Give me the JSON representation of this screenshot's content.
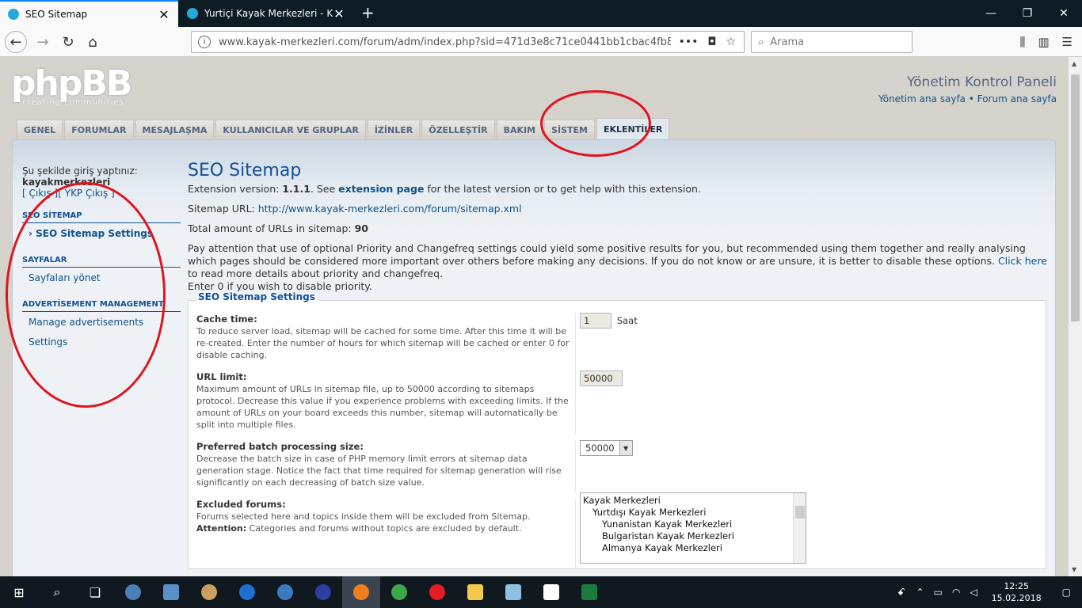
{
  "browser": {
    "tabs": [
      {
        "title": "SEO Sitemap"
      },
      {
        "title": "Yurtiçi Kayak Merkezleri - Kayak"
      }
    ],
    "url": "www.kayak-merkezleri.com/forum/adm/index.php?sid=471d3e8c71ce0441bb1cbac4fb8",
    "search_placeholder": "Arama",
    "new_tab": "+",
    "close_glyph": "✕",
    "page_actions": "•••"
  },
  "header": {
    "logo_text": "phpBB",
    "logo_tagline": "creating   communities",
    "title": "Yönetim Kontrol Paneli",
    "links": "Yönetim ana sayfa • Forum ana sayfa"
  },
  "nav_tabs": [
    {
      "label": "GENEL"
    },
    {
      "label": "FORUMLAR"
    },
    {
      "label": "MESAJLAŞMA"
    },
    {
      "label": "KULLANICILAR VE GRUPLAR"
    },
    {
      "label": "İZİNLER"
    },
    {
      "label": "ÖZELLEŞTİR"
    },
    {
      "label": "BAKIM"
    },
    {
      "label": "SİSTEM"
    },
    {
      "label": "EKLENTİLER"
    }
  ],
  "sidebar": {
    "login_text": "Şu şekilde giriş yaptınız:",
    "username": "kayakmerkezleri",
    "actions": "[ Çıkış ][ YKP Çıkış ]",
    "sections": [
      {
        "title": "SEO SİTEMAP",
        "items": [
          {
            "label": "SEO Sitemap Settings"
          }
        ]
      },
      {
        "title": "SAYFALAR",
        "items": [
          {
            "label": "Sayfaları yönet"
          }
        ]
      },
      {
        "title": "ADVERTİSEMENT MANAGEMENT",
        "items": [
          {
            "label": "Manage advertisements"
          },
          {
            "label": "Settings"
          }
        ]
      }
    ]
  },
  "main": {
    "title": "SEO Sitemap",
    "ext_prefix": "Extension version: ",
    "ext_version": "1.1.1",
    "ext_mid": ". See ",
    "ext_link": "extension page",
    "ext_suffix": " for the latest version or to get help with this extension.",
    "sitemap_label": "Sitemap URL: ",
    "sitemap_url": "http://www.kayak-merkezleri.com/forum/sitemap.xml",
    "total_label": "Total amount of URLs in sitemap: ",
    "total_value": "90",
    "notice_text": "Pay attention that use of optional Priority and Changefreq settings could yield some positive results for you, but recommended using them together and really analysing which pages should be considered more important over others before making any decisions. If you do not know or are unsure, it is better to disable these options. ",
    "notice_link": "Click here",
    "notice_suffix": " to read more details about priority and changefreq.",
    "notice_line2": "Enter 0 if you wish to disable priority.",
    "legend": "SEO Sitemap Settings",
    "cache": {
      "label": "Cache time:",
      "desc": "To reduce server load, sitemap will be cached for some time. After this time it will be re-created. Enter the number of hours for which sitemap will be cached or enter 0 for disable caching.",
      "value": "1",
      "unit": "Saat"
    },
    "url_limit": {
      "label": "URL limit:",
      "desc": "Maximum amount of URLs in sitemap file, up to 50000 according to sitemaps protocol. Decrease this value if you experience problems with exceeding limits. If the amount of URLs on your board exceeds this number, sitemap will automatically be split into multiple files.",
      "value": "50000"
    },
    "batch": {
      "label": "Preferred batch processing size:",
      "desc": "Decrease the batch size in case of PHP memory limit errors at sitemap data generation stage. Notice the fact that time required for sitemap generation will rise significantly on each decreasing of batch size value.",
      "value": "50000"
    },
    "excluded": {
      "label": "Excluded forums:",
      "desc": "Forums selected here and topics inside them will be excluded from Sitemap.",
      "attention_label": "Attention:",
      "attention_text": " Categories and forums without topics are excluded by default.",
      "options": [
        "Kayak Merkezleri",
        "Yurtdışı Kayak Merkezleri",
        "Yunanistan Kayak Merkezleri",
        "Bulgaristan Kayak Merkezleri",
        "Almanya Kayak Merkezleri"
      ]
    }
  },
  "taskbar": {
    "time": "12:25",
    "date": "15.02.2018"
  }
}
